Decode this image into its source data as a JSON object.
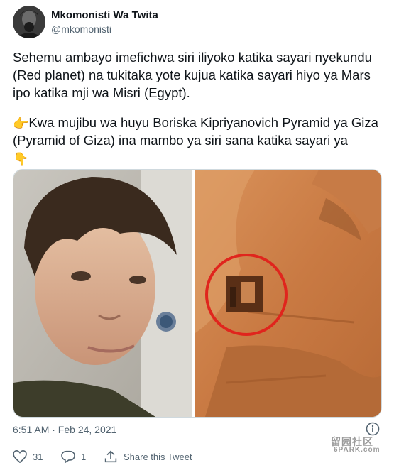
{
  "user": {
    "display_name": "Mkomonisti Wa Twita",
    "handle": "@mkomonisti"
  },
  "tweet": {
    "paragraph1": "Sehemu ambayo imefichwa siri iliyoko katika sayari nyekundu (Red planet) na tukitaka yote kujua katika sayari hiyo ya Mars ipo katika mji wa Misri (Egypt).",
    "paragraph2": "Kwa mujibu wa huyu Boriska Kipriyanovich Pyramid ya Giza (Pyramid of Giza) ina mambo ya siri sana katika sayari ya",
    "emoji_pointing_right": "👉",
    "emoji_pointing_down": "👇"
  },
  "meta": {
    "timestamp": "6:51 AM · Feb 24, 2021"
  },
  "actions": {
    "like_count": "31",
    "reply_count": "1",
    "share_label": "Share this Tweet"
  },
  "watermark": {
    "text": "留园社区",
    "url": "6PARK.com"
  },
  "icons": {
    "info": "info-icon",
    "like": "heart-icon",
    "reply": "reply-icon",
    "share": "share-icon"
  }
}
